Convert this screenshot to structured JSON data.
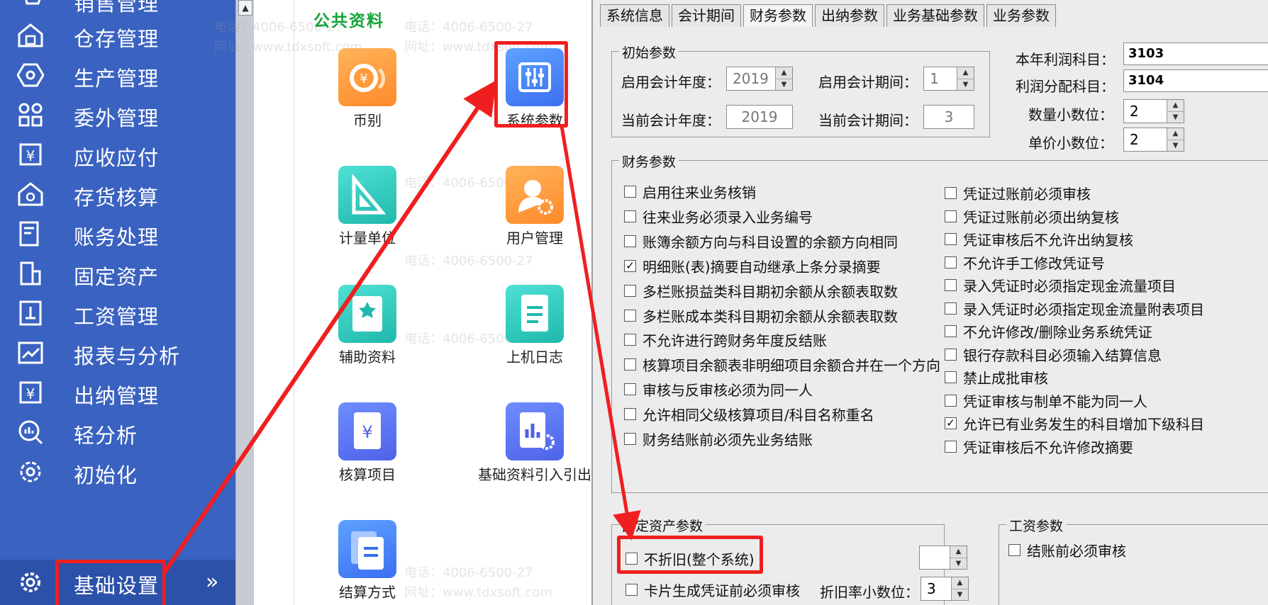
{
  "sidebar": {
    "items": [
      {
        "label": "销售管理",
        "icon": "cart-icon"
      },
      {
        "label": "仓存管理",
        "icon": "warehouse-icon"
      },
      {
        "label": "生产管理",
        "icon": "hexagon-icon"
      },
      {
        "label": "委外管理",
        "icon": "grid-icon"
      },
      {
        "label": "应收应付",
        "icon": "yen-icon"
      },
      {
        "label": "存货核算",
        "icon": "house-search-icon"
      },
      {
        "label": "账务处理",
        "icon": "ledger-icon"
      },
      {
        "label": "固定资产",
        "icon": "building-icon"
      },
      {
        "label": "工资管理",
        "icon": "salary-icon"
      },
      {
        "label": "报表与分析",
        "icon": "line-chart-icon"
      },
      {
        "label": "出纳管理",
        "icon": "cash-icon"
      },
      {
        "label": "轻分析",
        "icon": "magnify-chart-icon"
      },
      {
        "label": "初始化",
        "icon": "gear-outline-icon"
      },
      {
        "label": "基础设置",
        "icon": "gear-icon"
      }
    ],
    "chevron": "»"
  },
  "middle": {
    "title": "公共资料",
    "apps": [
      {
        "name": "币别",
        "icon": "coin-icon"
      },
      {
        "name": "系统参数",
        "icon": "sliders-icon"
      },
      {
        "name": "计量单位",
        "icon": "ruler-icon"
      },
      {
        "name": "用户管理",
        "icon": "user-gear-icon"
      },
      {
        "name": "辅助资料",
        "icon": "book-star-icon"
      },
      {
        "name": "上机日志",
        "icon": "document-icon"
      },
      {
        "name": "核算项目",
        "icon": "yen-doc-icon"
      },
      {
        "name": "基础资料引入引出",
        "icon": "chart-gear-icon"
      },
      {
        "name": "结算方式",
        "icon": "cards-icon"
      }
    ],
    "watermark_phone": "电话：4006-6500-27",
    "watermark_site": "网址：www.tdxsoft.com"
  },
  "tabs": [
    "系统信息",
    "会计期间",
    "财务参数",
    "出纳参数",
    "业务基础参数",
    "业务参数"
  ],
  "active_tab": "财务参数",
  "initial": {
    "title": "初始参数",
    "start_year_label": "启用会计年度：",
    "start_year": "2019",
    "start_period_label": "启用会计期间：",
    "start_period": "1",
    "current_year_label": "当前会计年度：",
    "current_year": "2019",
    "current_period_label": "当前会计期间：",
    "current_period": "3"
  },
  "side_params": {
    "profit_label": "本年利润科目：",
    "profit": "3103",
    "dist_label": "利润分配科目：",
    "dist": "3104",
    "qty_label": "数量小数位：",
    "qty": "2",
    "price_label": "单价小数位：",
    "price": "2"
  },
  "finance": {
    "title": "财务参数",
    "left": [
      {
        "label": "启用往来业务核销",
        "checked": false
      },
      {
        "label": "往来业务必须录入业务编号",
        "checked": false
      },
      {
        "label": "账簿余额方向与科目设置的余额方向相同",
        "checked": false
      },
      {
        "label": "明细账(表)摘要自动继承上条分录摘要",
        "checked": true
      },
      {
        "label": "多栏账损益类科目期初余额从余额表取数",
        "checked": false
      },
      {
        "label": "多栏账成本类科目期初余额从余额表取数",
        "checked": false
      },
      {
        "label": "不允许进行跨财务年度反结账",
        "checked": false
      },
      {
        "label": "核算项目余额表非明细项目余额合并在一个方向",
        "checked": false
      },
      {
        "label": "审核与反审核必须为同一人",
        "checked": false
      },
      {
        "label": "允许相同父级核算项目/科目名称重名",
        "checked": false
      },
      {
        "label": "财务结账前必须先业务结账",
        "checked": false
      }
    ],
    "right": [
      {
        "label": "凭证过账前必须审核",
        "checked": false
      },
      {
        "label": "凭证过账前必须出纳复核",
        "checked": false
      },
      {
        "label": "凭证审核后不允许出纳复核",
        "checked": false
      },
      {
        "label": "不允许手工修改凭证号",
        "checked": false
      },
      {
        "label": "录入凭证时必须指定现金流量项目",
        "checked": false
      },
      {
        "label": "录入凭证时必须指定现金流量附表项目",
        "checked": false
      },
      {
        "label": "不允许修改/删除业务系统凭证",
        "checked": false
      },
      {
        "label": "银行存款科目必须输入结算信息",
        "checked": false
      },
      {
        "label": "禁止成批审核",
        "checked": false
      },
      {
        "label": "凭证审核与制单不能为同一人",
        "checked": false
      },
      {
        "label": "允许已有业务发生的科目增加下级科目",
        "checked": true
      },
      {
        "label": "凭证审核后不允许修改摘要",
        "checked": false
      }
    ]
  },
  "fixed": {
    "title": "固定资产参数",
    "opt1": "不折旧(整个系统)",
    "opt2": "卡片生成凭证前必须审核",
    "decimal_label": "折旧率小数位：",
    "decimal": "3"
  },
  "salary": {
    "title": "工资参数",
    "opt1": "结账前必须审核"
  },
  "colors": {
    "sidebar": "#3a62c0",
    "highlight": "#f01f1f",
    "title_green": "#17a23b"
  }
}
